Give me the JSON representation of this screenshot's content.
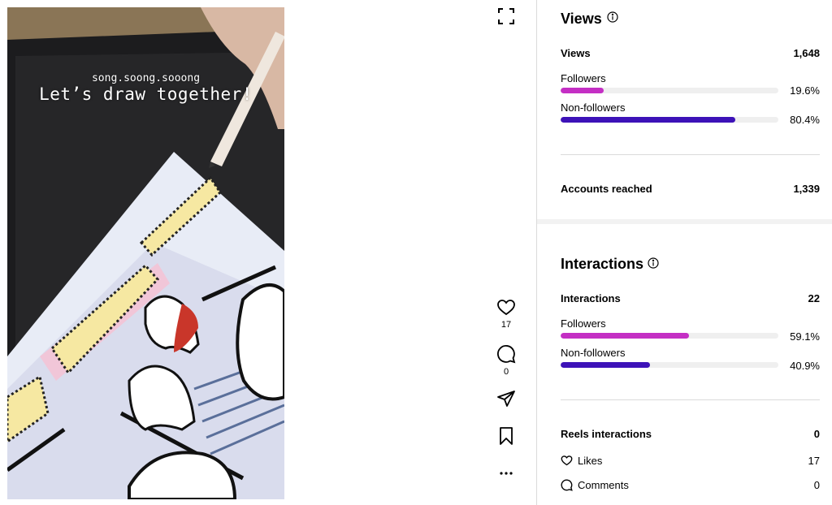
{
  "media": {
    "username_overlay": "song.soong.sooong",
    "caption_overlay": "Let’s draw together!"
  },
  "actions": {
    "likes_count": "17",
    "comments_count": "0"
  },
  "views": {
    "title": "Views",
    "label": "Views",
    "value": "1,648",
    "followers_label": "Followers",
    "followers_pct": "19.6%",
    "followers_fraction": 0.196,
    "nonfollowers_label": "Non-followers",
    "nonfollowers_pct": "80.4%",
    "nonfollowers_fraction": 0.804,
    "accounts_reached_label": "Accounts reached",
    "accounts_reached_value": "1,339"
  },
  "interactions": {
    "title": "Interactions",
    "label": "Interactions",
    "value": "22",
    "followers_label": "Followers",
    "followers_pct": "59.1%",
    "followers_fraction": 0.591,
    "nonfollowers_label": "Non-followers",
    "nonfollowers_pct": "40.9%",
    "nonfollowers_fraction": 0.409,
    "reels_label": "Reels interactions",
    "reels_value": "0",
    "likes_label": "Likes",
    "likes_value": "17",
    "comments_label": "Comments",
    "comments_value": "0"
  },
  "colors": {
    "followers_bar": "#c42fc4",
    "nonfollowers_bar": "#3d12b8",
    "bar_track": "#efefef",
    "divider": "#dbdbdb"
  },
  "icons": [
    "expand-icon",
    "heart-icon",
    "comment-icon",
    "share-icon",
    "bookmark-icon",
    "more-icon",
    "info-icon"
  ]
}
